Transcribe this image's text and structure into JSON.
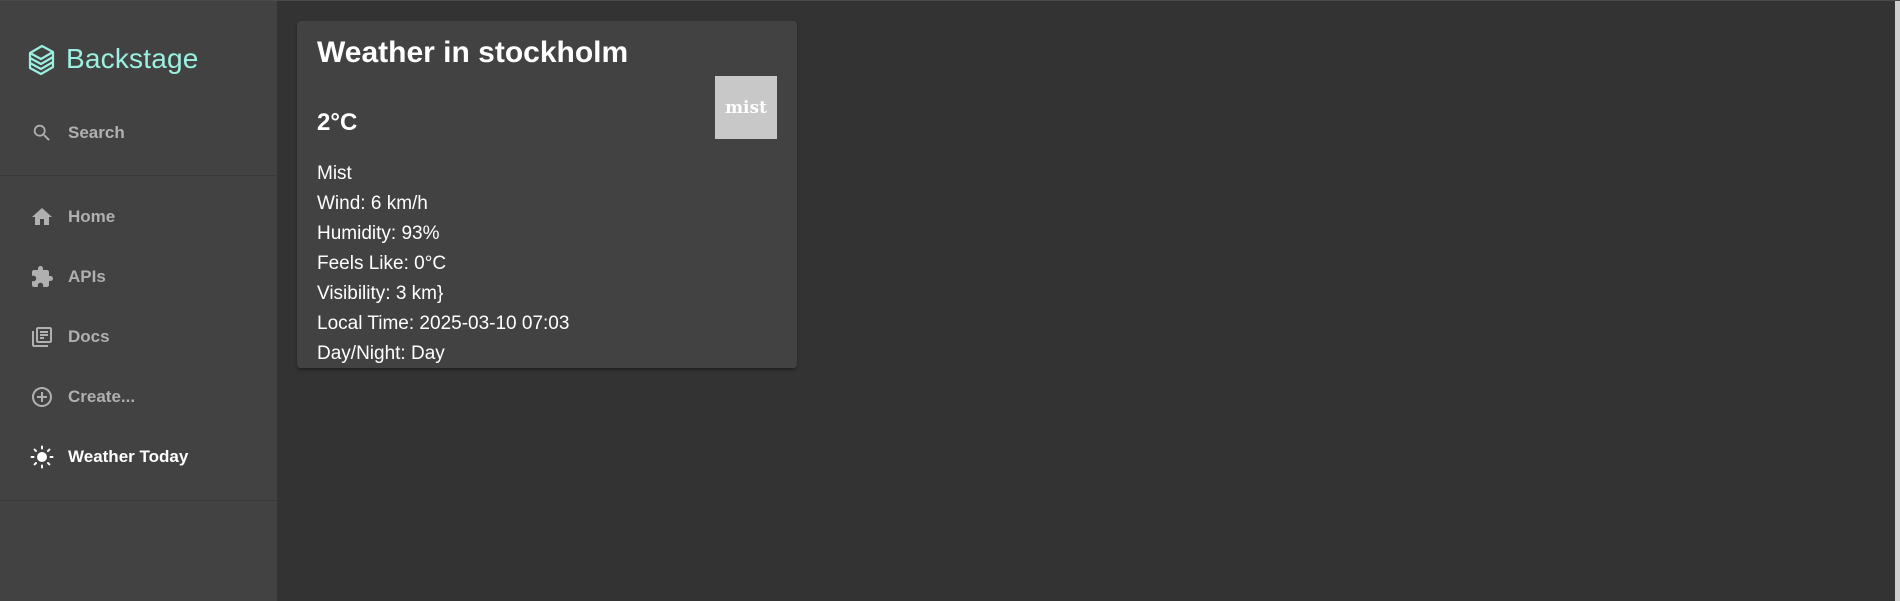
{
  "sidebar": {
    "logo_text": "Backstage",
    "search_label": "Search",
    "items": [
      {
        "label": "Home",
        "icon": "home-icon"
      },
      {
        "label": "APIs",
        "icon": "puzzle-icon"
      },
      {
        "label": "Docs",
        "icon": "library-books-icon"
      },
      {
        "label": "Create...",
        "icon": "add-circle-outline-icon"
      },
      {
        "label": "Weather Today",
        "icon": "sun-icon"
      }
    ]
  },
  "weather": {
    "title": "Weather in stockholm",
    "temperature": "2°C",
    "icon_text": "mist",
    "condition": "Mist",
    "wind": "Wind: 6 km/h",
    "humidity": "Humidity: 93%",
    "feels_like": "Feels Like: 0°C",
    "visibility": "Visibility: 3 km}",
    "local_time": "Local Time: 2025-03-10 07:03",
    "day_night": "Day/Night: Day"
  },
  "colors": {
    "page_background": "#333333",
    "sidebar_background": "#424242",
    "card_background": "#424242",
    "logo_accent": "#9bf0e1",
    "nav_text": "#b0b0b0",
    "nav_active_text": "#ffffff"
  }
}
